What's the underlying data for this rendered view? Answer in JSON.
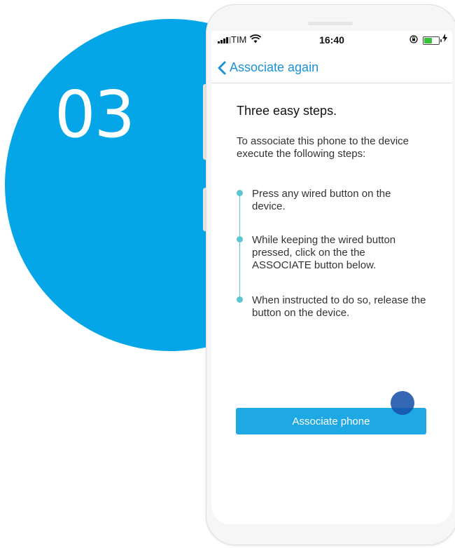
{
  "promo": {
    "step_number": "03",
    "accent_color": "#04a6e8"
  },
  "status_bar": {
    "carrier": "TIM",
    "time": "16:40",
    "icons": [
      "signal-icon",
      "wifi-icon",
      "orientation-lock-icon",
      "battery-icon",
      "charging-icon"
    ]
  },
  "nav": {
    "back_label": "Associate again",
    "back_icon": "chevron-left-icon"
  },
  "content": {
    "heading": "Three easy steps.",
    "intro": "To associate this phone to the device execute the following steps:",
    "steps": [
      {
        "text": "Press any wired button on the device."
      },
      {
        "text": "While keeping the wired button pressed, click on the the ASSOCIATE button below."
      },
      {
        "text": "When instructed to do so, release the button on the device."
      }
    ]
  },
  "actions": {
    "primary_label": "Associate phone",
    "primary_color": "#1ea8e4"
  }
}
